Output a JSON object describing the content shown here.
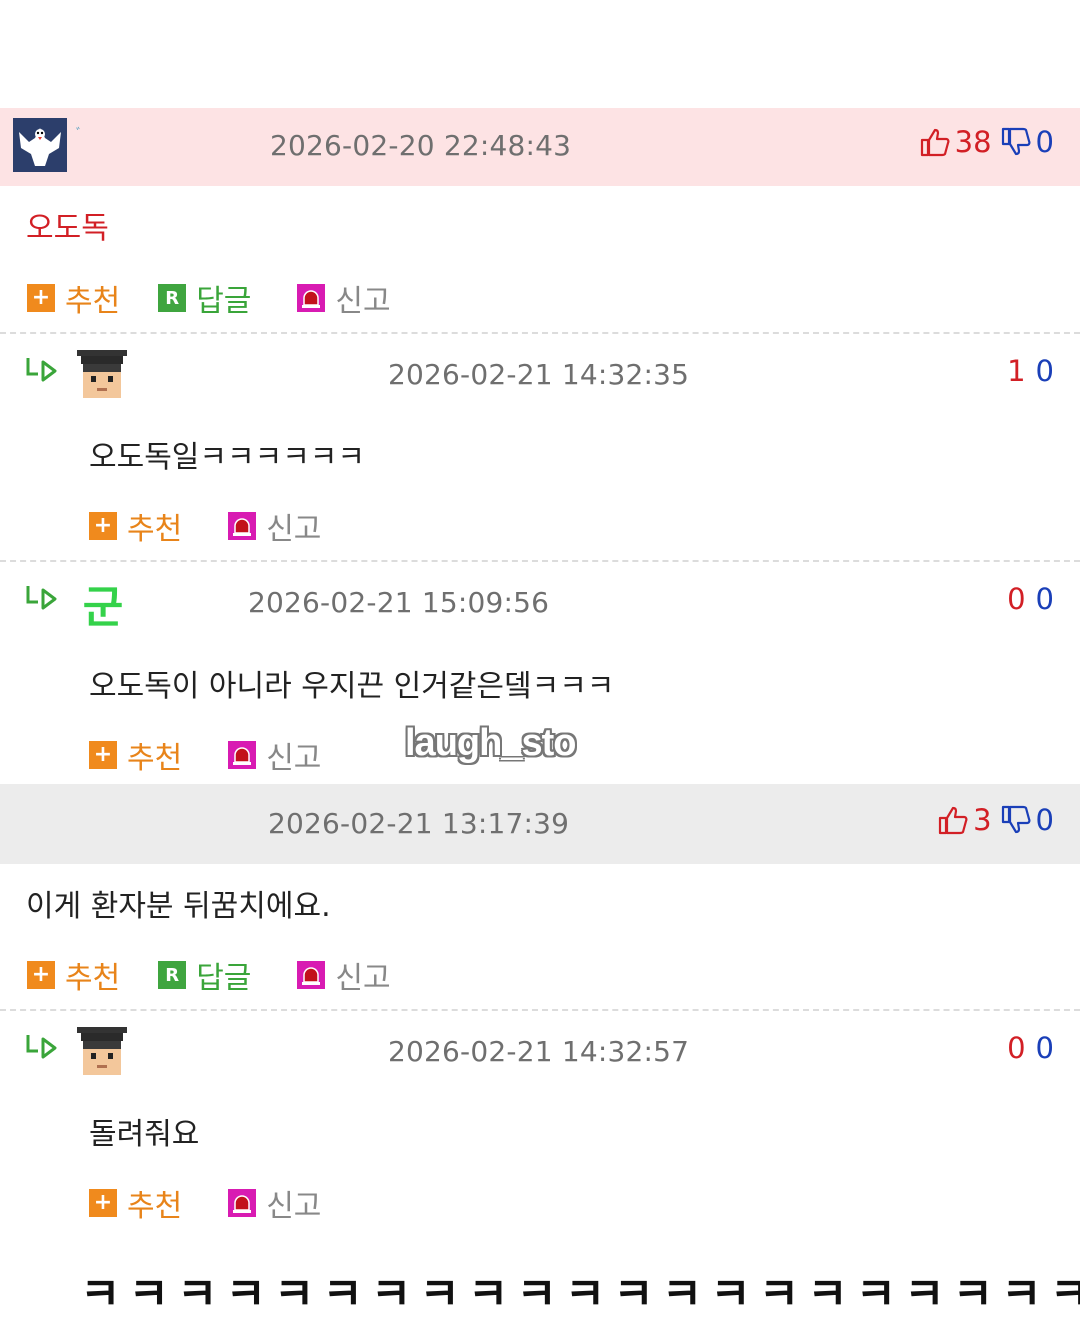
{
  "comment1": {
    "timestamp": "2026-02-20 22:48:43",
    "upvotes": "38",
    "downvotes": "0",
    "text": "오도독",
    "actions": {
      "recommend": "추천",
      "reply": "답글",
      "report": "신고"
    },
    "avatar_caption": "ﾞ"
  },
  "reply1": {
    "timestamp": "2026-02-21 14:32:35",
    "upvotes": "1",
    "downvotes": "0",
    "text": "오도독일ㅋㅋㅋㅋㅋㅋ",
    "actions": {
      "recommend": "추천",
      "report": "신고"
    }
  },
  "reply2": {
    "timestamp": "2026-02-21 15:09:56",
    "upvotes": "0",
    "downvotes": "0",
    "avatar_text": "군",
    "text": "오도독이 아니라 우지끈 인거같은뎈ㅋㅋㅋ",
    "actions": {
      "recommend": "추천",
      "report": "신고"
    }
  },
  "watermark": "laugh_sto",
  "comment2": {
    "timestamp": "2026-02-21 13:17:39",
    "upvotes": "3",
    "downvotes": "0",
    "text": "이게 환자분 뒤꿈치에요.",
    "actions": {
      "recommend": "추천",
      "reply": "답글",
      "report": "신고"
    }
  },
  "reply3": {
    "timestamp": "2026-02-21 14:32:57",
    "upvotes": "0",
    "downvotes": "0",
    "text": "돌려줘요",
    "actions": {
      "recommend": "추천",
      "report": "신고"
    }
  },
  "caption": "ㅋㅋㅋㅋㅋㅋㅋㅋㅋㅋㅋㅋㅋㅋㅋㅋㅋㅋㅋㅋㅋ",
  "colors": {
    "upvote": "#d21f25",
    "downvote": "#1a3fb8",
    "recommend": "#e8841a",
    "reply": "#3aa53a",
    "report_icon": "#d81bb2",
    "pink_bar": "#fde3e4",
    "gray_bar": "#ececec"
  }
}
